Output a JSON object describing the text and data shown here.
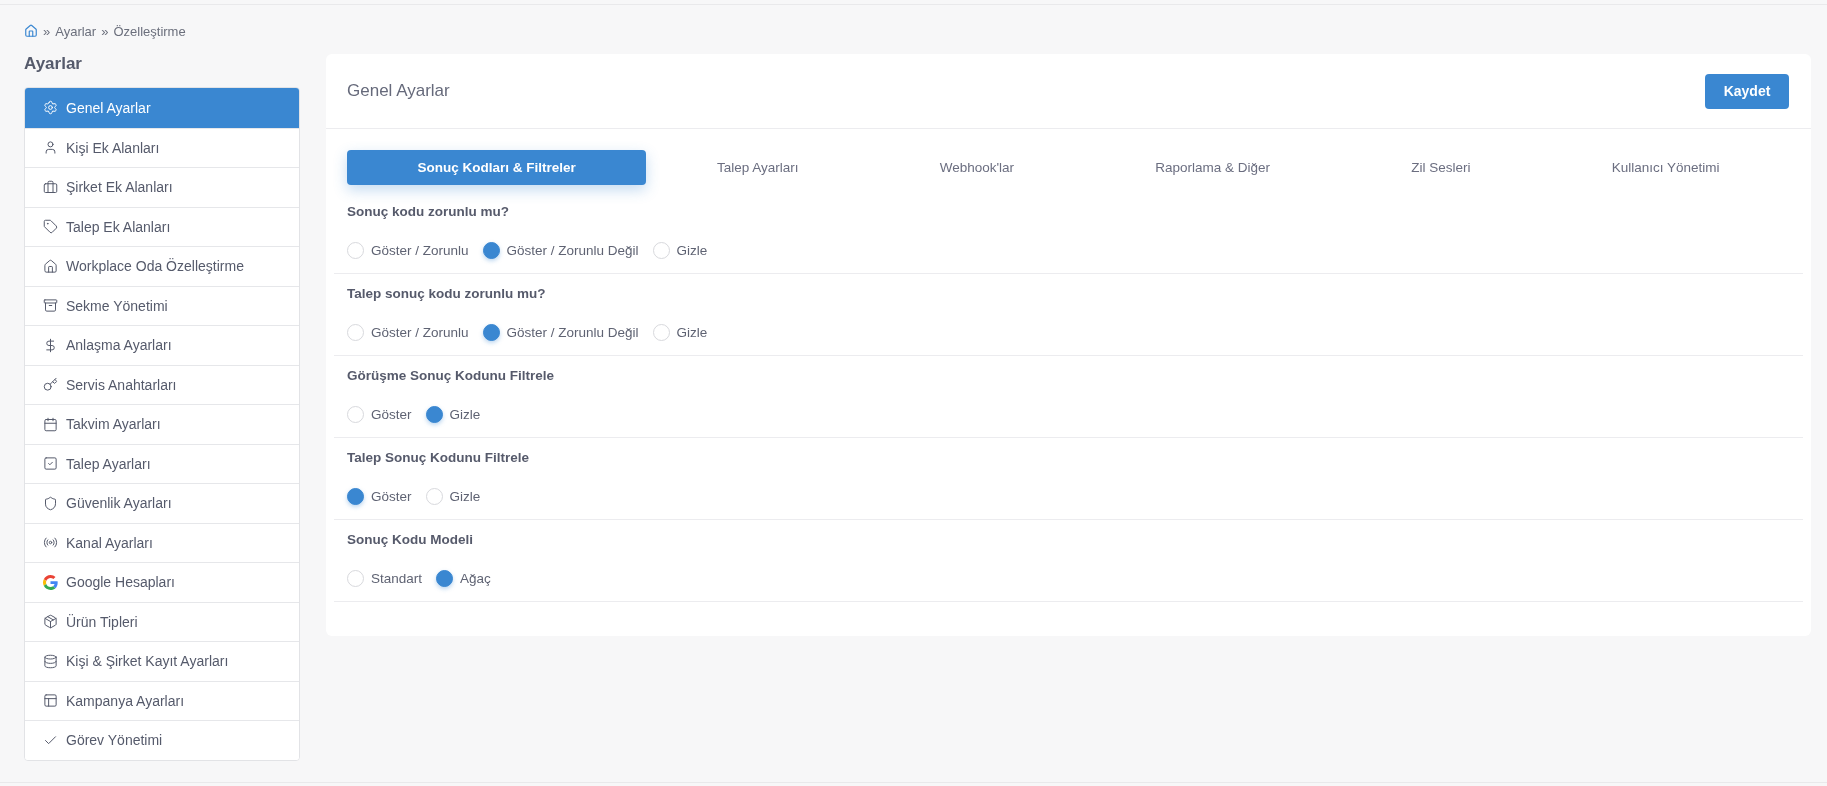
{
  "breadcrumb": [
    {
      "separator": "»",
      "label": "Ayarlar"
    },
    {
      "separator": "»",
      "label": "Özelleştirme"
    }
  ],
  "sidebar": {
    "title": "Ayarlar",
    "items": [
      {
        "label": "Genel Ayarlar",
        "selected": true
      },
      {
        "label": "Kişi Ek Alanları",
        "selected": false
      },
      {
        "label": "Şirket Ek Alanları",
        "selected": false
      },
      {
        "label": "Talep Ek Alanları",
        "selected": false
      },
      {
        "label": "Workplace Oda Özelleştirme",
        "selected": false
      },
      {
        "label": "Sekme Yönetimi",
        "selected": false
      },
      {
        "label": "Anlaşma Ayarları",
        "selected": false
      },
      {
        "label": "Servis Anahtarları",
        "selected": false
      },
      {
        "label": "Takvim Ayarları",
        "selected": false
      },
      {
        "label": "Talep Ayarları",
        "selected": false
      },
      {
        "label": "Güvenlik Ayarları",
        "selected": false
      },
      {
        "label": "Kanal Ayarları",
        "selected": false
      },
      {
        "label": "Google Hesapları",
        "selected": false
      },
      {
        "label": "Ürün Tipleri",
        "selected": false
      },
      {
        "label": "Kişi & Şirket Kayıt Ayarları",
        "selected": false
      },
      {
        "label": "Kampanya Ayarları",
        "selected": false
      },
      {
        "label": "Görev Yönetimi",
        "selected": false
      }
    ]
  },
  "panel": {
    "title": "Genel Ayarlar",
    "save_button": "Kaydet",
    "tabs": [
      {
        "label": "Sonuç Kodları & Filtreler",
        "selected": true
      },
      {
        "label": "Talep Ayarları",
        "selected": false
      },
      {
        "label": "Webhook'lar",
        "selected": false
      },
      {
        "label": "Raporlama & Diğer",
        "selected": false
      },
      {
        "label": "Zil Sesleri",
        "selected": false
      },
      {
        "label": "Kullanıcı Yönetimi",
        "selected": false
      }
    ],
    "settings": [
      {
        "question": "Sonuç kodu zorunlu mu?",
        "options": [
          {
            "label": "Göster / Zorunlu",
            "selected": false
          },
          {
            "label": "Göster / Zorunlu Değil",
            "selected": true
          },
          {
            "label": "Gizle",
            "selected": false
          }
        ]
      },
      {
        "question": "Talep sonuç kodu zorunlu mu?",
        "options": [
          {
            "label": "Göster / Zorunlu",
            "selected": false
          },
          {
            "label": "Göster / Zorunlu Değil",
            "selected": true
          },
          {
            "label": "Gizle",
            "selected": false
          }
        ]
      },
      {
        "question": "Görüşme Sonuç Kodunu Filtrele",
        "options": [
          {
            "label": "Göster",
            "selected": false
          },
          {
            "label": "Gizle",
            "selected": true
          }
        ]
      },
      {
        "question": "Talep Sonuç Kodunu Filtrele",
        "options": [
          {
            "label": "Göster",
            "selected": true
          },
          {
            "label": "Gizle",
            "selected": false
          }
        ]
      },
      {
        "question": "Sonuç Kodu Modeli",
        "options": [
          {
            "label": "Standart",
            "selected": false
          },
          {
            "label": "Ağaç",
            "selected": true
          }
        ]
      }
    ]
  }
}
